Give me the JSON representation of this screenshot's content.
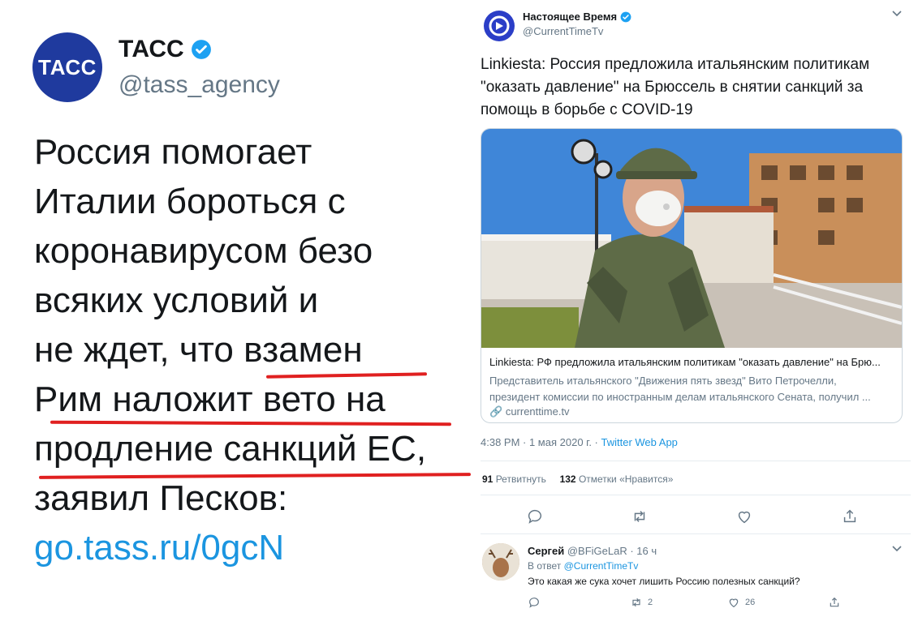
{
  "left_tweet": {
    "avatar_text": "ТАСС",
    "name": "ТАСС",
    "handle": "@tass_agency",
    "lines": [
      "Россия помогает",
      "Италии бороться с",
      "коронавирусом безо",
      "всяких условий и",
      "не ждет, что взамен",
      "Рим наложит вето на",
      "продление санкций ЕС,",
      "заявил Песков:"
    ],
    "link": "go.tass.ru/0gcN"
  },
  "right_tweet": {
    "name": "Настоящее Время",
    "handle": "@CurrentTimeTv",
    "text": "Linkiesta: Россия предложила итальянским политикам \"оказать давление\" на Брюссель в снятии санкций за помощь в борьбе с COVID-19",
    "card": {
      "title": "Linkiesta: РФ предложила итальянским политикам \"оказать давление\" на Брю...",
      "desc_lines": [
        "Представитель итальянского \"Движения пять звезд\" Вито Петрочелли,",
        "президент комиссии по иностранным делам итальянского Сената, получил ..."
      ],
      "domain": "currenttime.tv"
    },
    "timestamp": "4:38 PM · 1 мая 2020 г. · ",
    "app": "Twitter Web App",
    "retweets_count": "91",
    "retweets_label": "Ретвитнуть",
    "likes_count": "132",
    "likes_label": "Отметки «Нравится»"
  },
  "reply": {
    "name": "Сергей",
    "handle": "@BFiGeLaR · 16 ч",
    "to_prefix": "В ответ ",
    "to_handle": "@CurrentTimeTv",
    "text": "Это какая же сука хочет лишить Россию полезных санкций?",
    "retweets": "2",
    "likes": "26"
  },
  "colors": {
    "twitter_blue": "#1b95e0",
    "tass_blue": "#1f3a9e",
    "underline_red": "#e02020"
  }
}
